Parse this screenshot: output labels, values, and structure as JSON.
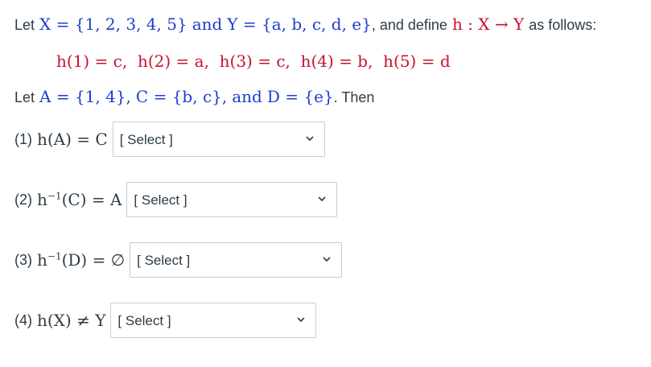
{
  "intro": {
    "let": "Let",
    "X_def": "X = {1, 2, 3, 4, 5}",
    "and": "and",
    "Y_def": "Y = {a, b, c, d, e}",
    "comma_define": ", and define",
    "h_map": "h : X → Y",
    "as_follows": "as follows:"
  },
  "mapping": "h(1) = c,  h(2) = a,  h(3) = c,  h(4) = b,  h(5) = d",
  "sets_line": {
    "let": "Let",
    "A_def": "A = {1, 4},",
    "C_def": "C = {b, c},",
    "and": "and",
    "D_def": "D = {e}",
    "then": ". Then"
  },
  "questions": [
    {
      "number": "(1)",
      "expr": "h(A) = C",
      "selected": "[ Select ]"
    },
    {
      "number": "(2)",
      "expr_pre": "h",
      "expr_sup": "−1",
      "expr_post": "(C) = A",
      "selected": "[ Select ]"
    },
    {
      "number": "(3)",
      "expr_pre": "h",
      "expr_sup": "−1",
      "expr_post": "(D) = ∅",
      "selected": "[ Select ]"
    },
    {
      "number": "(4)",
      "expr": "h(X) ≠ Y",
      "selected": "[ Select ]"
    }
  ],
  "colors": {
    "text": "#2d3b45",
    "math_red": "#c8102e",
    "math_blue": "#1d3ccf",
    "border": "#c7cdd1"
  },
  "icons": {
    "dropdown": "chevron-down-icon"
  }
}
